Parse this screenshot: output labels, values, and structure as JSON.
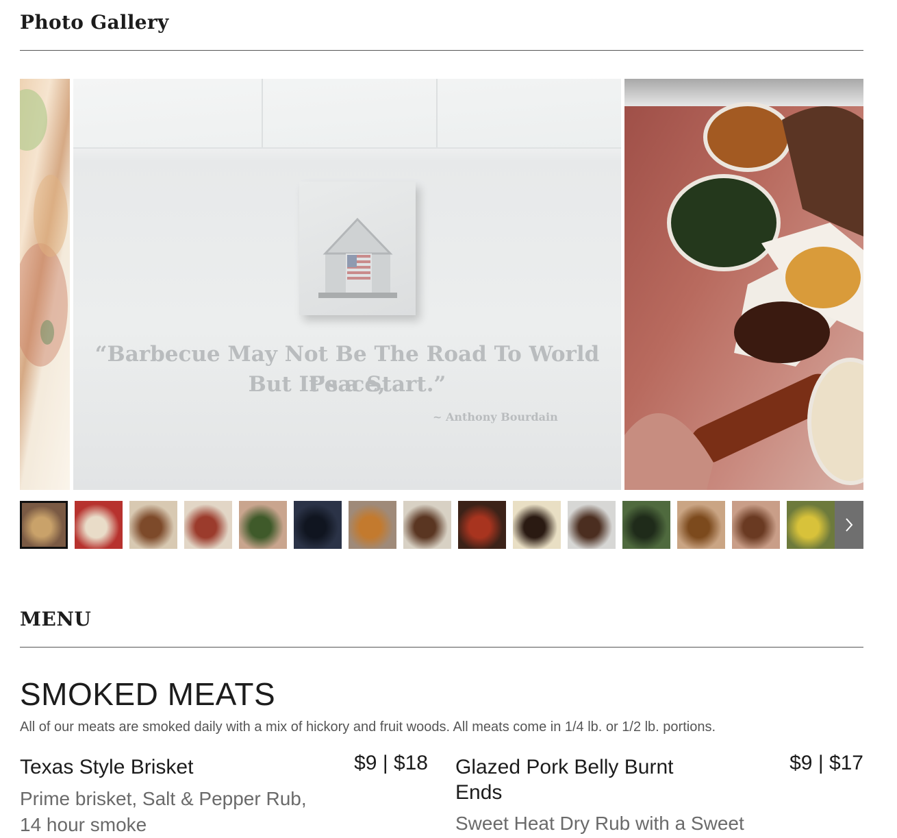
{
  "gallery": {
    "title": "Photo Gallery",
    "slides": [
      {
        "name": "tacos"
      },
      {
        "name": "wall-quote",
        "quote_line1": "“Barbecue May Not Be The Road To World Peace,",
        "quote_line2": "But It’s a Start.”",
        "attribution": "~ Anthony Bourdain"
      },
      {
        "name": "bbq-tray"
      }
    ],
    "thumbnails": [
      {
        "color": "#7a5a44",
        "accent": "#c9a26a"
      },
      {
        "color": "#b7322e",
        "accent": "#e9dcc8"
      },
      {
        "color": "#d8c9b2",
        "accent": "#7d4a2a"
      },
      {
        "color": "#e2d6c6",
        "accent": "#9b3b2c"
      },
      {
        "color": "#c9a58e",
        "accent": "#3f5a2a"
      },
      {
        "color": "#2b3347",
        "accent": "#101520"
      },
      {
        "color": "#9f8a79",
        "accent": "#c37a2e"
      },
      {
        "color": "#d8d1c4",
        "accent": "#5a3622"
      },
      {
        "color": "#3c2218",
        "accent": "#a8341f"
      },
      {
        "color": "#e9dfc4",
        "accent": "#2a1a12"
      },
      {
        "color": "#d7d7d5",
        "accent": "#4b2e20"
      },
      {
        "color": "#4f6a3e",
        "accent": "#1f2b1a"
      },
      {
        "color": "#caa584",
        "accent": "#7c4a1d"
      },
      {
        "color": "#c99e88",
        "accent": "#6a3a22"
      },
      {
        "color": "#6d7a3c",
        "accent": "#d8c23a"
      }
    ],
    "next_icon": "chevron-right-icon"
  },
  "menu": {
    "title": "MENU",
    "category": {
      "title": "SMOKED MEATS",
      "description": "All of our meats are smoked daily with a mix of hickory and fruit woods. All meats come in 1/4 lb. or 1/2 lb. portions."
    },
    "items": [
      {
        "name": "Texas Style Brisket",
        "price": "$9 | $18",
        "description": "Prime brisket, Salt & Pepper Rub, 14 hour smoke"
      },
      {
        "name": "Glazed Pork Belly Burnt Ends",
        "price": "$9 | $17",
        "description": "Sweet Heat Dry Rub with a Sweet"
      }
    ]
  },
  "colors": {
    "text": "#1c1c1c",
    "muted": "#6a6a6a",
    "rule": "#555555",
    "active_border": "#111111"
  }
}
